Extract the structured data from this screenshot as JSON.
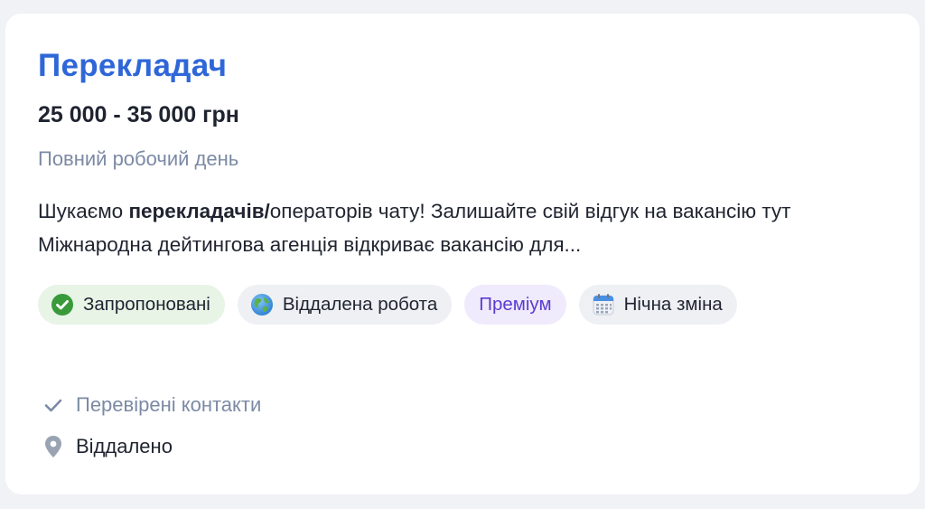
{
  "job": {
    "title": "Перекладач",
    "salary": "25 000 - 35 000 грн",
    "schedule": "Повний робочий день",
    "description": {
      "part1": "Шукаємо ",
      "bold": "перекладачів/",
      "part2": "операторів чату! Залишайте свій відгук на вакансію тут Міжнародна дейтингова агенція відкриває вакансію для..."
    },
    "tags": [
      {
        "label": "Запропоновані",
        "icon": "green-check-circle-icon",
        "color": "#e7f4e6"
      },
      {
        "label": "Віддалена робота",
        "icon": "globe-icon",
        "color": "#eef0f4"
      },
      {
        "label": "Преміум",
        "icon": "",
        "color": "#efeafc"
      },
      {
        "label": "Нічна зміна",
        "icon": "calendar-icon",
        "color": "#eef0f4"
      }
    ],
    "verified_contacts": "Перевірені контакти",
    "location": "Віддалено"
  },
  "colors": {
    "title": "#2f67d8",
    "muted": "#7c8aa5",
    "text": "#1f2430",
    "premium_text": "#5b3ccf"
  }
}
